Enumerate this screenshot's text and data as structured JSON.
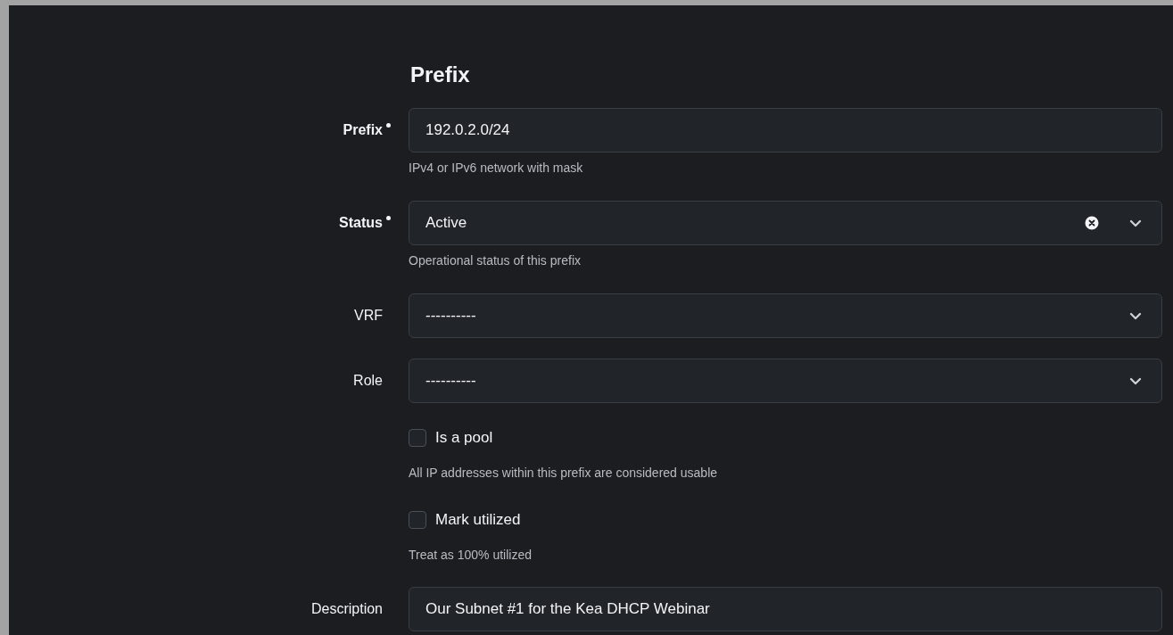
{
  "section_title": "Prefix",
  "fields": [
    {
      "kind": "text",
      "label": "Prefix",
      "required": true,
      "value": "192.0.2.0/24",
      "help": "IPv4 or IPv6 network with mask"
    },
    {
      "kind": "select",
      "label": "Status",
      "required": true,
      "value": "Active",
      "clearable": true,
      "help": "Operational status of this prefix"
    },
    {
      "kind": "select",
      "label": "VRF",
      "required": false,
      "value": "----------",
      "clearable": false
    },
    {
      "kind": "select",
      "label": "Role",
      "required": false,
      "value": "----------",
      "clearable": false
    },
    {
      "kind": "checkbox",
      "label": "Is a pool",
      "checked": false,
      "help": "All IP addresses within this prefix are considered usable"
    },
    {
      "kind": "checkbox",
      "label": "Mark utilized",
      "checked": false,
      "help": "Treat as 100% utilized"
    },
    {
      "kind": "text",
      "label": "Description",
      "required": false,
      "value": "Our Subnet #1 for the Kea DHCP Webinar"
    }
  ]
}
